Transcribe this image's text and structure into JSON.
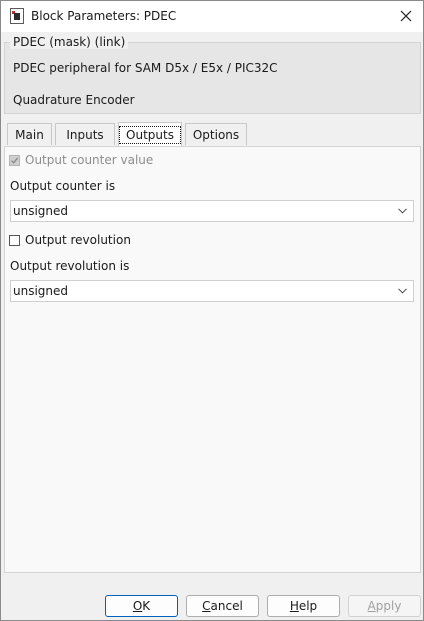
{
  "window": {
    "title": "Block Parameters: PDEC",
    "app_icon": "simulink-block-icon",
    "close_icon": "close-icon"
  },
  "mask": {
    "legend": "PDEC (mask) (link)",
    "description": "PDEC peripheral for SAM D5x / E5x / PIC32C",
    "subtitle": "Quadrature Encoder"
  },
  "tabs": [
    {
      "label": "Main"
    },
    {
      "label": "Inputs"
    },
    {
      "label": "Outputs",
      "active": true
    },
    {
      "label": "Options"
    }
  ],
  "outputs": {
    "output_counter_value": {
      "label": "Output counter value",
      "checked": true,
      "enabled": false
    },
    "output_counter_is": {
      "label": "Output counter is",
      "value": "unsigned"
    },
    "output_revolution": {
      "label": "Output revolution",
      "checked": false
    },
    "output_revolution_is": {
      "label": "Output revolution is",
      "value": "unsigned"
    }
  },
  "buttons": {
    "ok": {
      "mnemonic": "O",
      "rest": "K"
    },
    "cancel": {
      "mnemonic": "C",
      "rest": "ancel"
    },
    "help": {
      "mnemonic": "H",
      "rest": "elp"
    },
    "apply": {
      "mnemonic": "A",
      "rest": "pply"
    }
  }
}
